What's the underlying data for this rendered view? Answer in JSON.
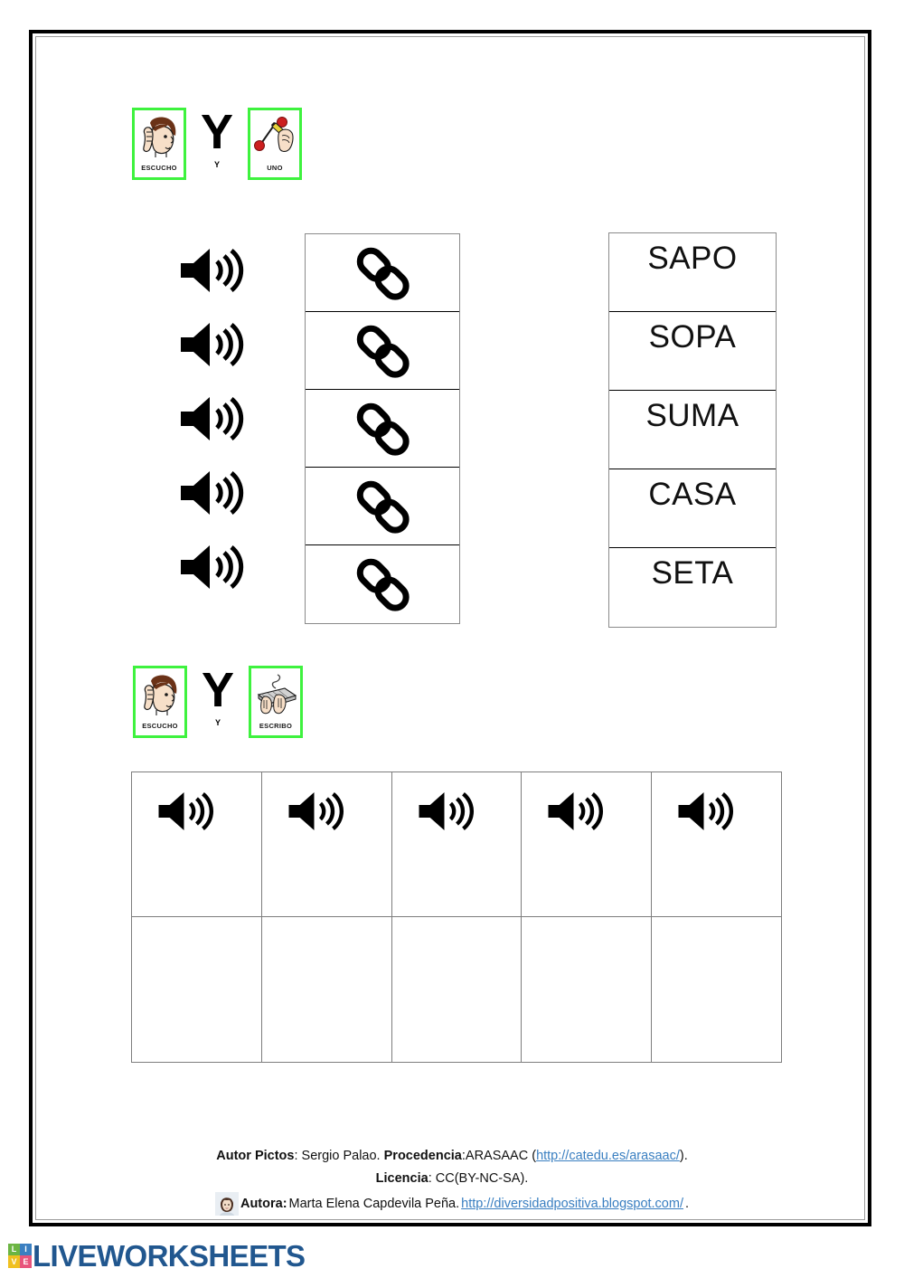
{
  "worksheet": {
    "page_background": "#ffffff",
    "frame_color": "#000000",
    "frame_inner_color": "#9a9a9a"
  },
  "instruction_1": {
    "left_picto": {
      "icon": "listening-head-icon",
      "label": "ESCUCHO"
    },
    "conjunction": {
      "big": "Y",
      "small": "Y"
    },
    "right_picto": {
      "icon": "hand-drawing-line-icon",
      "label": "UNO"
    },
    "border_color": "#3ef23e"
  },
  "instruction_2": {
    "left_picto": {
      "icon": "listening-head-icon",
      "label": "ESCUCHO"
    },
    "conjunction": {
      "big": "Y",
      "small": "Y"
    },
    "right_picto": {
      "icon": "hands-typing-keyboard-icon",
      "label": "ESCRIBO"
    },
    "border_color": "#3ef23e"
  },
  "exercise_1": {
    "audio_buttons": [
      {
        "icon": "speaker-icon"
      },
      {
        "icon": "speaker-icon"
      },
      {
        "icon": "speaker-icon"
      },
      {
        "icon": "speaker-icon"
      },
      {
        "icon": "speaker-icon"
      }
    ],
    "link_cells": [
      {
        "icon": "chain-link-icon"
      },
      {
        "icon": "chain-link-icon"
      },
      {
        "icon": "chain-link-icon"
      },
      {
        "icon": "chain-link-icon"
      },
      {
        "icon": "chain-link-icon"
      }
    ],
    "words": [
      "SAPO",
      "SOPA",
      "SUMA",
      "CASA",
      "SETA"
    ]
  },
  "exercise_2": {
    "audio_cells": [
      {
        "icon": "speaker-icon"
      },
      {
        "icon": "speaker-icon"
      },
      {
        "icon": "speaker-icon"
      },
      {
        "icon": "speaker-icon"
      },
      {
        "icon": "speaker-icon"
      }
    ],
    "answer_cells": [
      "",
      "",
      "",
      "",
      ""
    ]
  },
  "credits": {
    "line1": {
      "label_author": "Autor Pictos",
      "author_value": ": Sergio Palao.  ",
      "label_source": "Procedencia",
      "source_value": ":ARASAAC (",
      "source_link": "http://catedu.es/arasaac/",
      "source_tail": ")."
    },
    "line2": {
      "label_license": "Licencia",
      "license_value": ": CC(BY-NC-SA)."
    },
    "line3": {
      "avatar": "author-avatar-icon",
      "label_authoress": "Autora:",
      "authoress_value": " Marta Elena Capdevila Peña. ",
      "blog_link": "http://diversidadpositiva.blogspot.com/",
      "blog_tail": "."
    },
    "link_color": "#3a7fc1"
  },
  "branding": {
    "tiles": [
      {
        "letter": "L",
        "color": "#6cb543"
      },
      {
        "letter": "I",
        "color": "#3a7fc1"
      },
      {
        "letter": "V",
        "color": "#f0c020"
      },
      {
        "letter": "E",
        "color": "#e8547c"
      }
    ],
    "wordmark": "LIVEWORKSHEETS",
    "wordmark_color": "#21578f"
  }
}
